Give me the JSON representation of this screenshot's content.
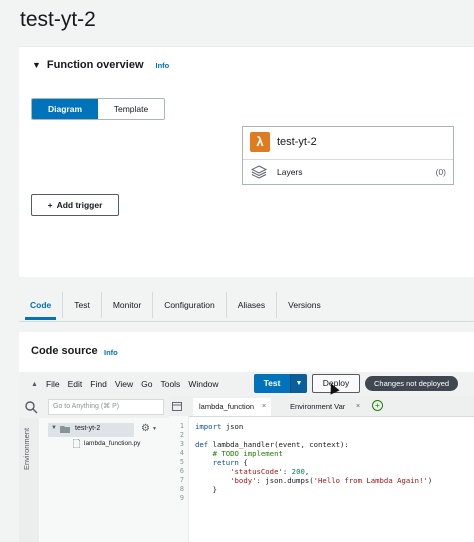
{
  "page_title": "test-yt-2",
  "function_overview": {
    "title": "Function overview",
    "info": "Info",
    "views": [
      "Diagram",
      "Template"
    ],
    "active_view": "Diagram",
    "function_name": "test-yt-2",
    "layers_label": "Layers",
    "layers_count": "(0)",
    "add_trigger": "Add trigger"
  },
  "tabs": [
    {
      "label": "Code",
      "active": true
    },
    {
      "label": "Test",
      "active": false
    },
    {
      "label": "Monitor",
      "active": false
    },
    {
      "label": "Configuration",
      "active": false
    },
    {
      "label": "Aliases",
      "active": false
    },
    {
      "label": "Versions",
      "active": false
    }
  ],
  "code_source": {
    "title": "Code source",
    "info": "Info"
  },
  "ide": {
    "menu": [
      "File",
      "Edit",
      "Find",
      "View",
      "Go",
      "Tools",
      "Window"
    ],
    "test_button": "Test",
    "deploy_button": "Deploy",
    "status_badge": "Changes not deployed",
    "search_placeholder": "Go to Anything (⌘ P)",
    "environment_label": "Environment",
    "tree": {
      "folder": "test-yt-2",
      "file": "lambda_function.py"
    },
    "editor_tabs": [
      "lambda_function",
      "Environment Var"
    ],
    "line_numbers": [
      "1",
      "2",
      "3",
      "4",
      "5",
      "6",
      "7",
      "8",
      "9"
    ],
    "code": {
      "l1_kw": "import",
      "l1_rest": " json",
      "l3_kw": "def",
      "l3_rest": " lambda_handler(event, context):",
      "l4_comment": "    # TODO implement",
      "l5_kw": "    return",
      "l5_rest": " {",
      "l6_key": "        'statusCode'",
      "l6_colon": ": ",
      "l6_val": "200",
      "l6_end": ",",
      "l7_key": "        'body'",
      "l7_mid": ": json.dumps(",
      "l7_str": "'Hello from Lambda Again!'",
      "l7_end": ")",
      "l8": "    }"
    }
  },
  "colors": {
    "accent": "#0073bb",
    "lambda_orange": "#e07b1f",
    "badge_bg": "#414750"
  }
}
